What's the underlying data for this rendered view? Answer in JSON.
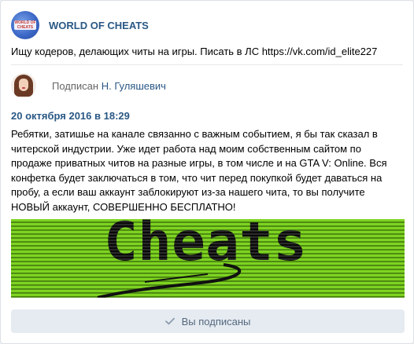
{
  "group": {
    "name": "WORLD OF CHEATS",
    "avatar_text": "WORLD OF CHEATS"
  },
  "status": "Ищу кодеров, делающих читы на игры. Писать в ЛС https://vk.com/id_elite227",
  "subscriber": {
    "prefix": "Подписан",
    "name": "Н. Гуляшевич"
  },
  "post": {
    "date": "20 октября 2016 в 18:29",
    "text": "Ребятки, затишье на канале связанно с важным событием, я бы так сказал в читерской индустрии. Уже идет работа над моим собственным сайтом по продаже приватных читов на разные игры, в том числе и на GTA V: Online. Вся конфетка будет заключаться в том, что чит перед покупкой будет даваться на пробу, а если ваш аккаунт заблокируют из-за нашего чита, то вы получите НОВЫЙ аккаунт, СОВЕРШЕННО БЕСПЛАТНО!",
    "image_word": "Cheats"
  },
  "button": {
    "label": "Вы подписаны",
    "icon": "check-icon"
  },
  "colors": {
    "link": "#2a5885",
    "button_bg": "#e5ebf1",
    "button_text": "#55677d",
    "image_green": "#7ed321"
  }
}
